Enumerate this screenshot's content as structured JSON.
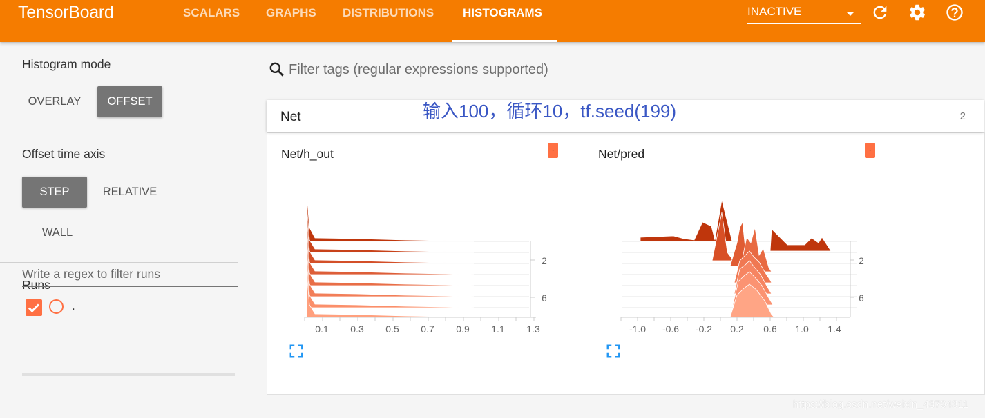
{
  "topbar": {
    "brand": "TensorBoard",
    "tabs": [
      {
        "label": "SCALARS",
        "active": false
      },
      {
        "label": "GRAPHS",
        "active": false
      },
      {
        "label": "DISTRIBUTIONS",
        "active": false
      },
      {
        "label": "HISTOGRAMS",
        "active": true
      }
    ],
    "reload_status": "INACTIVE",
    "icons": [
      "refresh-icon",
      "settings-gear-icon",
      "help-icon"
    ]
  },
  "sidebar": {
    "histogram_mode": {
      "title": "Histogram mode",
      "options": [
        "OVERLAY",
        "OFFSET"
      ],
      "selected": "OFFSET"
    },
    "time_axis": {
      "title": "Offset time axis",
      "options": [
        "STEP",
        "RELATIVE",
        "WALL"
      ],
      "selected": "STEP"
    },
    "runs": {
      "title": "Runs",
      "filter_placeholder": "Write a regex to filter runs",
      "items": [
        {
          "name": ".",
          "checked": true
        }
      ]
    }
  },
  "main": {
    "search_placeholder": "Filter tags (regular expressions supported)",
    "annotation": "输入100，循环10，tf.seed(199)",
    "group": {
      "name": "Net",
      "count": "2"
    },
    "cards": [
      {
        "title": "Net/h_out",
        "run_chip": ".",
        "x_ticks": [
          "0.1",
          "0.3",
          "0.5",
          "0.7",
          "0.9",
          "1.1",
          "1.3"
        ],
        "y_ticks": [
          "2",
          "6"
        ]
      },
      {
        "title": "Net/pred",
        "run_chip": ".",
        "x_ticks": [
          "-1.0",
          "-0.6",
          "-0.2",
          "0.2",
          "0.6",
          "1.0",
          "1.4"
        ],
        "y_ticks": [
          "2",
          "6"
        ]
      }
    ]
  },
  "colors": {
    "topbar": "#f57c00",
    "accent": "#ff7043",
    "histogram_dark": "#bf360c",
    "histogram_light": "#ffab91"
  },
  "watermark": "https://blog.csdn.net/weixin_43794311"
}
